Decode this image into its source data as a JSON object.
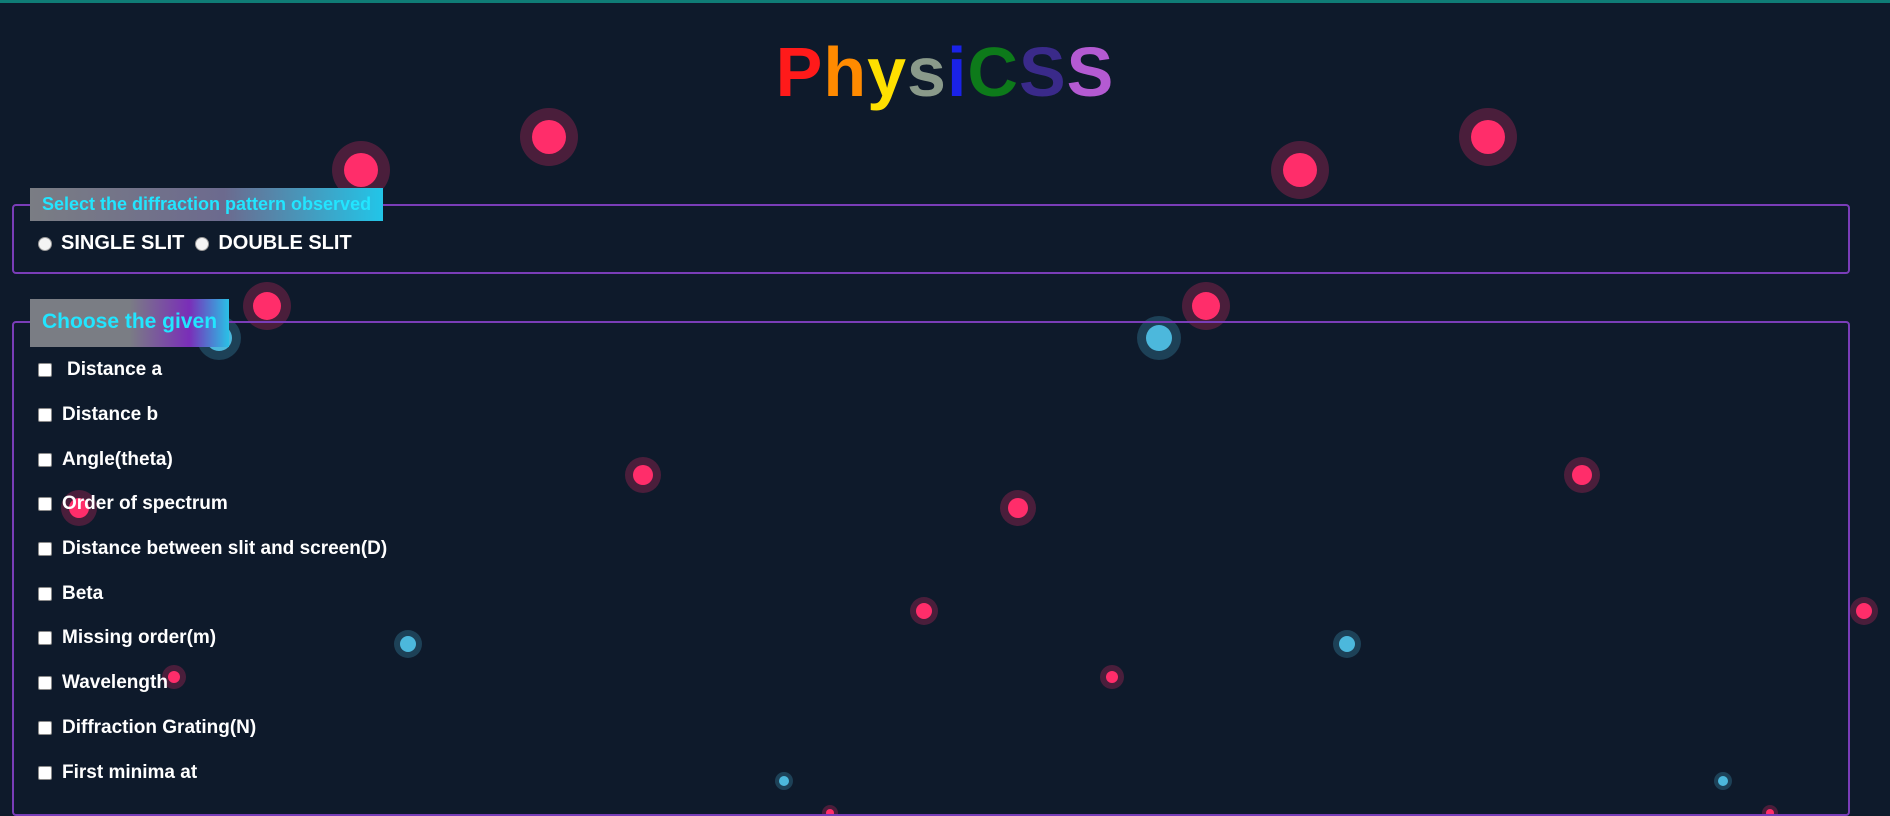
{
  "app": {
    "title": "PhysiCSS",
    "title_letters": [
      {
        "ch": "P",
        "color": "#ff1a1a"
      },
      {
        "ch": "h",
        "color": "#ff8a00"
      },
      {
        "ch": "y",
        "color": "#ffe000"
      },
      {
        "ch": "s",
        "color": "#8a9a8a"
      },
      {
        "ch": "i",
        "color": "#1a22e8"
      },
      {
        "ch": "C",
        "color": "#0d7a1a"
      },
      {
        "ch": "S",
        "color": "#3a2a8a"
      },
      {
        "ch": "S",
        "color": "#b45ad2"
      }
    ]
  },
  "pattern": {
    "legend": "Select the diffraction pattern observed",
    "options": [
      {
        "label": "SINGLE SLIT",
        "selected": false
      },
      {
        "label": "DOUBLE SLIT",
        "selected": false
      }
    ]
  },
  "given": {
    "legend": "Choose the given",
    "items": [
      {
        "label": " Distance a",
        "checked": false
      },
      {
        "label": "Distance b",
        "checked": false
      },
      {
        "label": "Angle(theta)",
        "checked": false
      },
      {
        "label": "Order of spectrum",
        "checked": false
      },
      {
        "label": "Distance between slit and screen(D)",
        "checked": false
      },
      {
        "label": "Beta",
        "checked": false
      },
      {
        "label": "Missing order(m)",
        "checked": false
      },
      {
        "label": "Wavelength",
        "checked": false
      },
      {
        "label": "Diffraction Grating(N)",
        "checked": false
      },
      {
        "label": "First minima at",
        "checked": false
      }
    ]
  },
  "colors": {
    "background": "#0e1a2b",
    "border": "#7a3db8",
    "legend_text": "#22e5ff",
    "bubble_pink": "#ff2d6a",
    "bubble_blue": "#4cb8dc"
  }
}
